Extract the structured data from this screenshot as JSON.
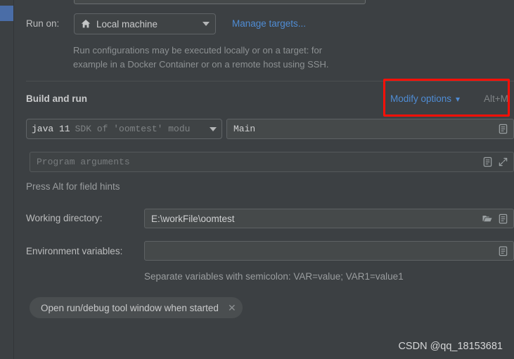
{
  "window": {
    "background_color": "#3c4043",
    "accent_link_color": "#4f8cd4",
    "annotation_color": "#fc1008"
  },
  "run_on_row": {
    "label": "Run on:",
    "dropdown_value": "Local machine",
    "dropdown_icon": "home-icon",
    "manage_link": "Manage targets...",
    "description": "Run configurations may be executed locally or on a target: for\nexample in a Docker Container or on a remote host using SSH."
  },
  "build_and_run": {
    "section_title": "Build and run",
    "modify_options_label": "Modify options",
    "modify_options_chevron": "chevron-down-icon",
    "shortcut_hint": "Alt+M",
    "jdk": {
      "name": "java 11",
      "description": "SDK of 'oomtest' modu"
    },
    "main_class": {
      "value": "Main",
      "macro_icon": "expand-macro-icon"
    },
    "program_arguments": {
      "placeholder": "Program arguments",
      "macro_icon": "expand-macro-icon",
      "expand_icon": "expand-editor-icon"
    },
    "alt_hint": "Press Alt for field hints"
  },
  "working_directory": {
    "label": "Working directory:",
    "value": "E:\\workFile\\oomtest",
    "browse_icon": "folder-icon",
    "macro_icon": "expand-macro-icon"
  },
  "environment_variables": {
    "label": "Environment variables:",
    "value": "",
    "macro_icon": "expand-macro-icon",
    "hint": "Separate variables with semicolon: VAR=value; VAR1=value1"
  },
  "option_chips": [
    {
      "label": "Open run/debug tool window when started",
      "close_icon": "close-icon"
    }
  ],
  "watermark": "CSDN @qq_18153681"
}
